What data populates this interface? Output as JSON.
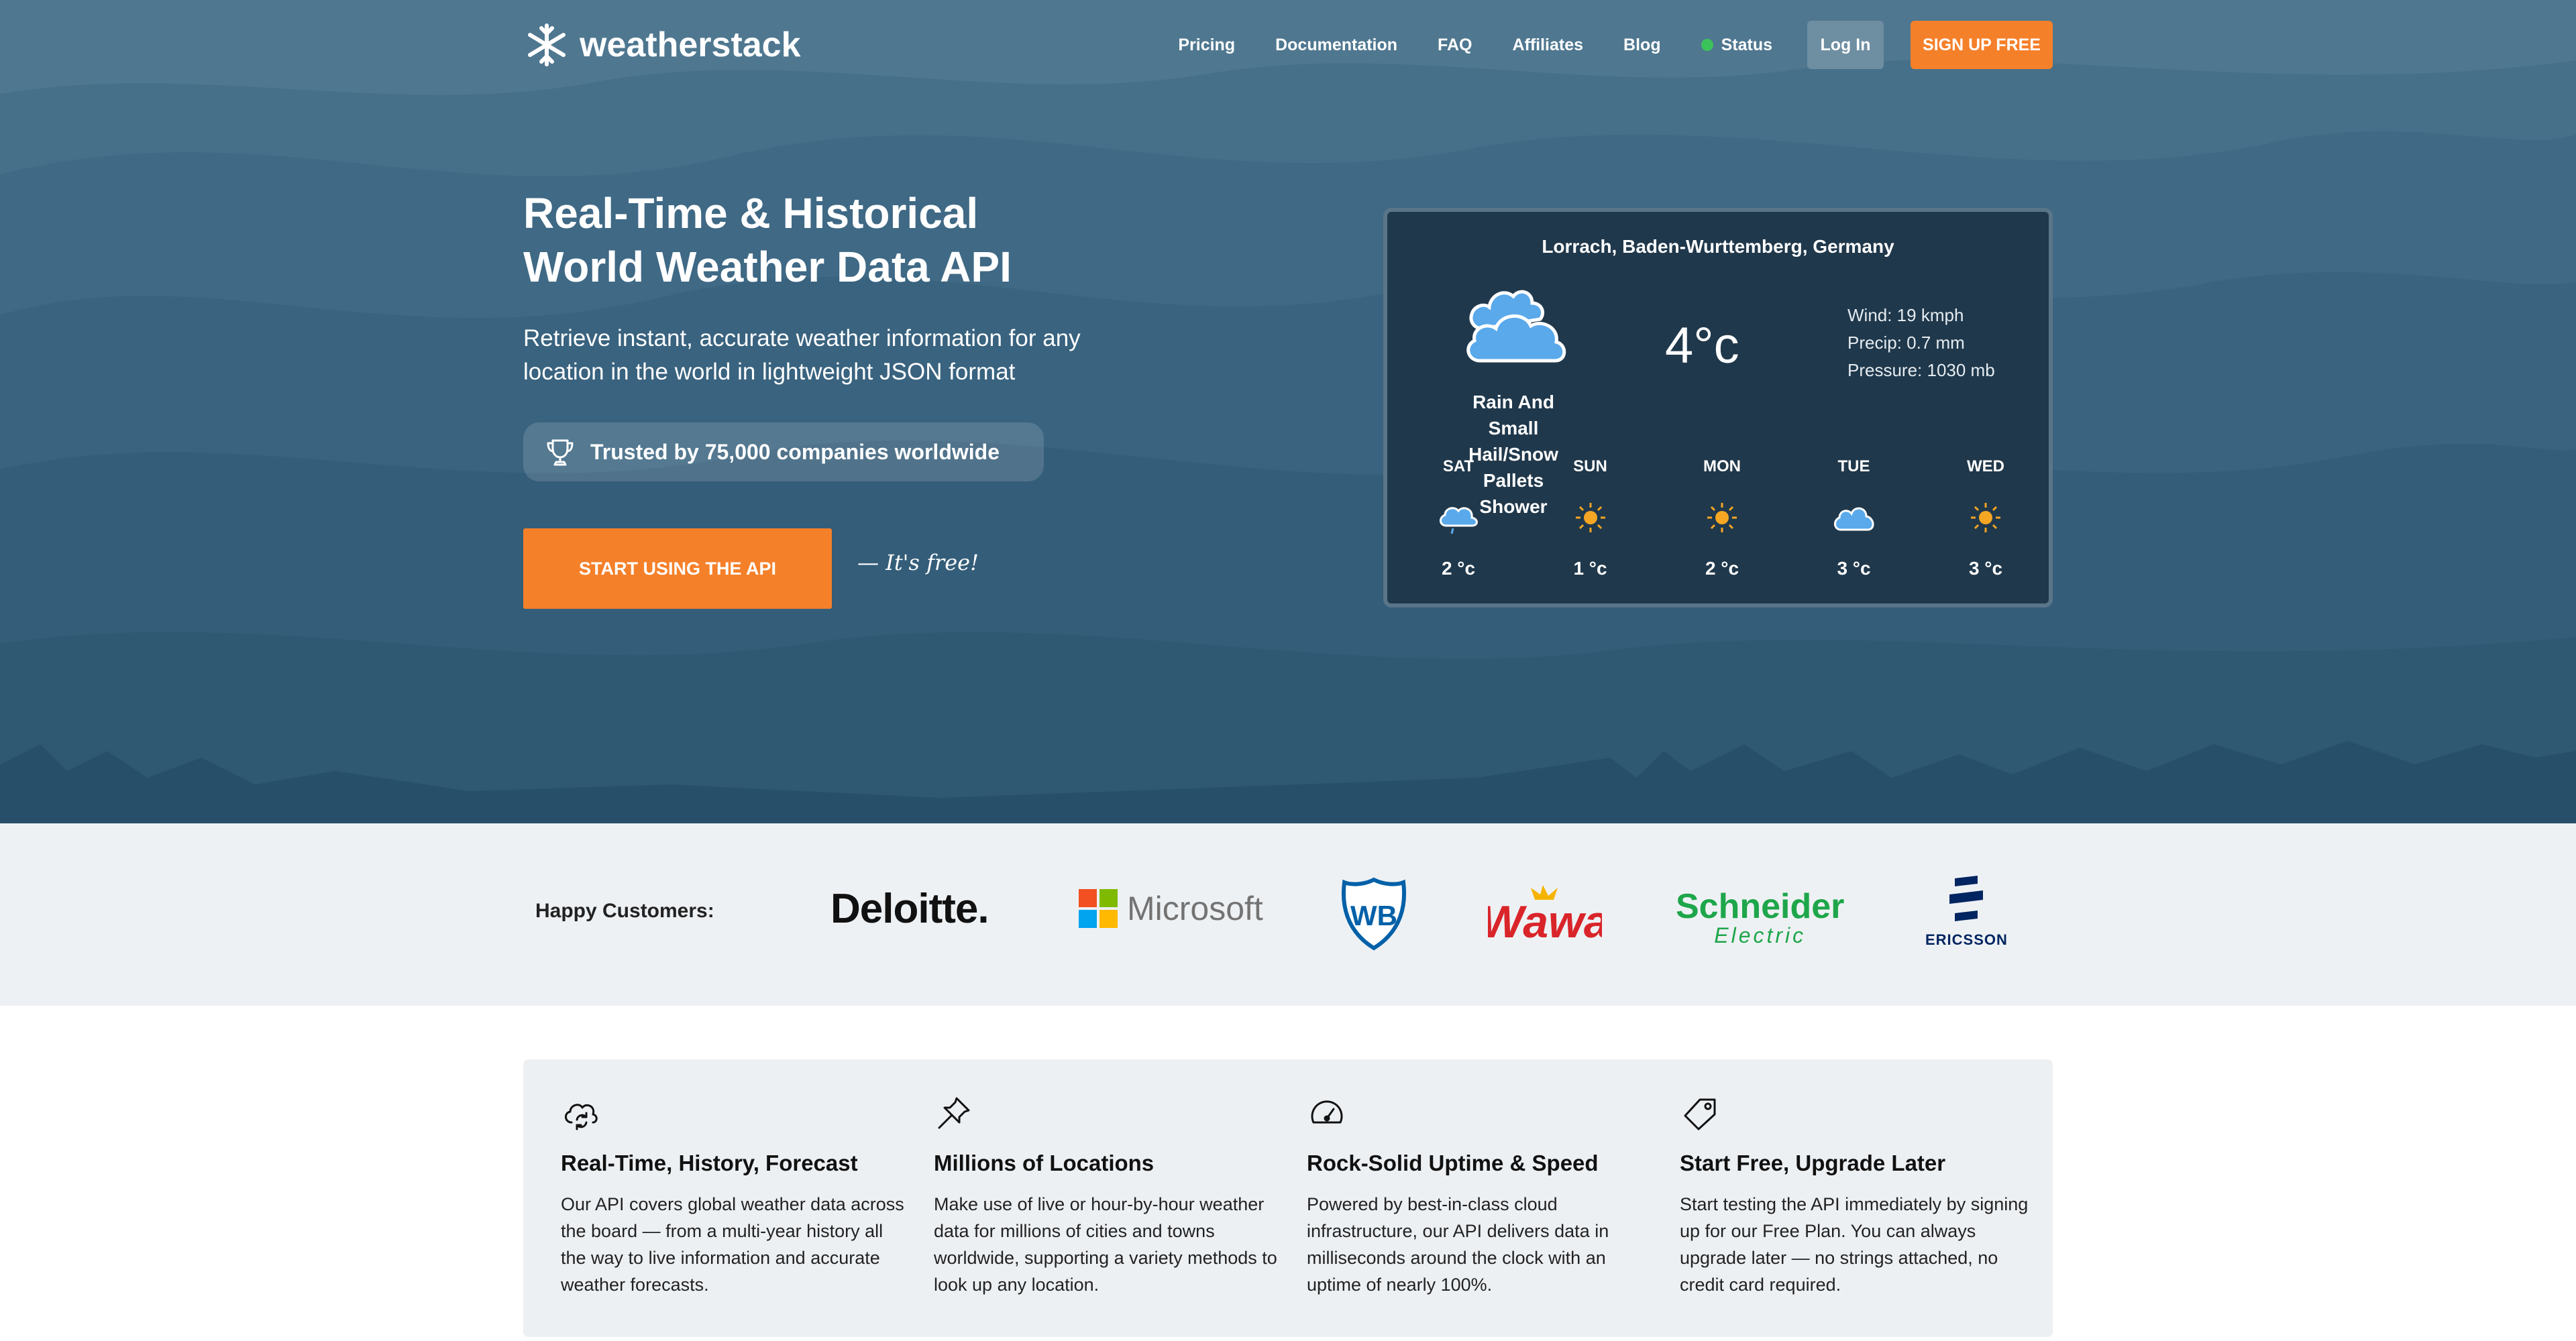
{
  "brand": {
    "name": "weatherstack"
  },
  "nav": {
    "links": [
      "Pricing",
      "Documentation",
      "FAQ",
      "Affiliates",
      "Blog"
    ],
    "status": "Status",
    "login": "Log In",
    "signup": "SIGN UP FREE"
  },
  "hero": {
    "headline_line1": "Real-Time & Historical",
    "headline_line2": "World Weather Data API",
    "subhead": "Retrieve instant, accurate weather information for any location in the world in lightweight JSON format",
    "trust": "Trusted by 75,000 companies worldwide",
    "cta": "START USING THE API",
    "free_note": "— It's free!"
  },
  "widget": {
    "location": "Lorrach, Baden-Wurttemberg, Germany",
    "icon": "cloud-icon",
    "condition": "Rain And Small Hail/Snow Pallets Shower",
    "temperature": "4°c",
    "wind": "Wind: 19 kmph",
    "precip": "Precip: 0.7 mm",
    "pressure": "Pressure: 1030 mb",
    "forecast": [
      {
        "day": "SAT",
        "temp": "2 °c",
        "icon": "cloud-rain-icon"
      },
      {
        "day": "SUN",
        "temp": "1 °c",
        "icon": "sun-icon"
      },
      {
        "day": "MON",
        "temp": "2 °c",
        "icon": "sun-icon"
      },
      {
        "day": "TUE",
        "temp": "3 °c",
        "icon": "cloud-icon"
      },
      {
        "day": "WED",
        "temp": "3 °c",
        "icon": "sun-icon"
      }
    ]
  },
  "customers": {
    "label": "Happy Customers:",
    "logos": [
      "Deloitte.",
      "Microsoft",
      "WB",
      "Wawa",
      "Schneider",
      "Electric",
      "ERICSSON"
    ]
  },
  "features": [
    {
      "icon": "cloud-sync-icon",
      "title": "Real-Time, History, Forecast",
      "desc": "Our API covers global weather data across the board — from a multi-year history all the way to live information and accurate weather forecasts."
    },
    {
      "icon": "pin-icon",
      "title": "Millions of Locations",
      "desc": "Make use of live or hour-by-hour weather data for millions of cities and towns worldwide, supporting a variety methods to look up any location."
    },
    {
      "icon": "speedometer-icon",
      "title": "Rock-Solid Uptime & Speed",
      "desc": "Powered by best-in-class cloud infrastructure, our API delivers data in milliseconds around the clock with an uptime of nearly 100%."
    },
    {
      "icon": "tag-icon",
      "title": "Start Free, Upgrade Later",
      "desc": "Start testing the API immediately by signing up for our Free Plan. You can always upgrade later — no strings attached, no credit card required."
    }
  ],
  "colors": {
    "accent": "#f5802a",
    "hero_bg": "#3e6a86",
    "widget_bg": "#20384b",
    "status_green": "#3cc25a"
  }
}
